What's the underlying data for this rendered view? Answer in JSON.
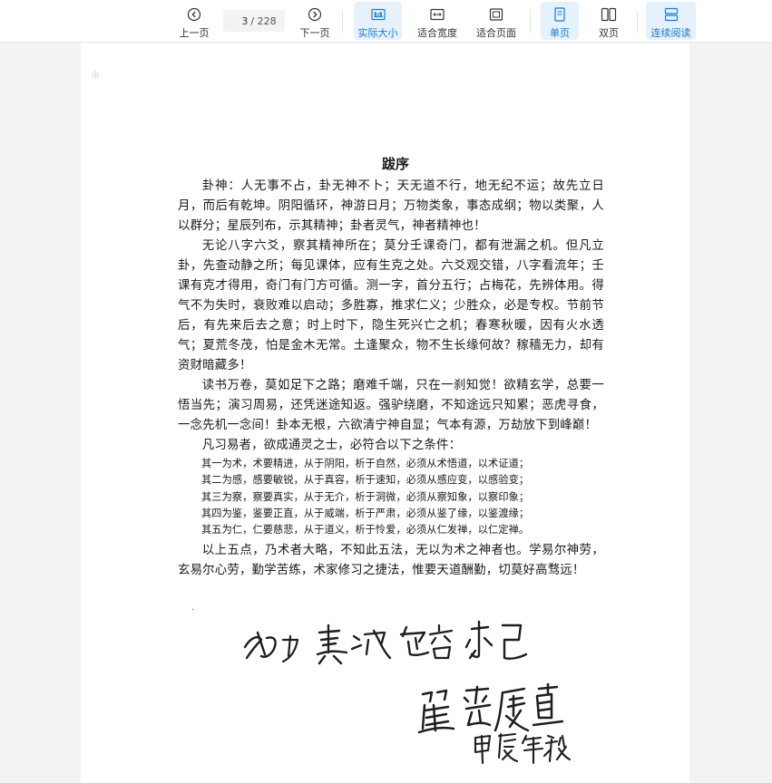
{
  "toolbar": {
    "prev_label": "上一页",
    "current_page": "3",
    "total_pages": "/ 228",
    "next_label": "下一页",
    "actual_size_label": "实际大小",
    "actual_size_icon_text": "1:1",
    "fit_width_label": "适合宽度",
    "fit_page_label": "适合页面",
    "single_page_label": "单页",
    "double_page_label": "双页",
    "continuous_label": "连续阅读"
  },
  "document": {
    "title": "跋序",
    "paragraphs": [
      "卦神：人无事不占，卦无神不卜；天无道不行，地无纪不运；故先立日月，而后有乾坤。阴阳循环，神游日月；万物类象，事态成纲；物以类聚，人以群分；星辰列布，示其精神；卦者灵气，神者精神也！",
      "无论八字六爻，察其精神所在；莫分壬课奇门，都有泄漏之机。但凡立卦，先查动静之所；每见课体，应有生克之处。六爻观交错，八字看流年；壬课有克才得用，奇门有门方可循。测一字，首分五行；占梅花，先辨体用。得气不为失时，衰败难以启动；多胜寡，推求仁义；少胜众，必是专权。节前节后，有先来后去之意；时上时下，隐生死兴亡之机；春寒秋暖，因有火水透气；夏荒冬茂，怕是金木无常。土逢聚众，物不生长缘何故？稼穑无力，却有资财暗藏多！",
      "读书万卷，莫如足下之路；磨难千端，只在一刹知觉！欲精玄学，总要一悟当先；演习周易，还凭迷途知返。强驴绕磨，不知途远只知累；恶虎寻食，一念先机一念间！卦本无根，六欲清宁神自显；气本有源，万劫放下到峰巅！",
      "凡习易者，欲成通灵之士，必符合以下之条件："
    ],
    "conditions": [
      "其一为术，术要精进，从于阴阳，析于自然，必须从术悟道，以术证道；",
      "其二为感，感要敏锐，从于真容，析于速知，必须从感应变，以感验变；",
      "其三为察，察要真实，从于无介，析于洞微，必须从察知象，以察印象；",
      "其四为鉴，鉴要正直，从于威端，析于严肃，必须从鉴了缘，以鉴渡缘；",
      "其五为仁，仁要慈悲，从于道义，析于怜爱，必须从仁发禅，以仁定禅。"
    ],
    "closing": "以上五点，乃术者大略，不知此五法，无以为术之神者也。学易尔神劳，玄易尔心劳，勤学苦练，术家修习之捷法，惟要天道酬勤，切莫好高骛远！",
    "handwritten_motto": "努力 真诚 包容 求己",
    "handwritten_name": "瞿香广直",
    "handwritten_date": "甲辰年秋"
  }
}
